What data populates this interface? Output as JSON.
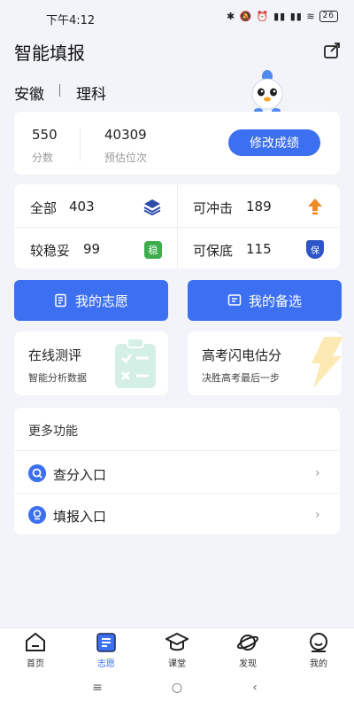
{
  "status": {
    "time": "下午4:12",
    "icons": "✱ 🔕 ⏰ ▮▮ ▮▮ ≋",
    "battery": "26"
  },
  "header": {
    "title": "智能填报"
  },
  "profile": {
    "province": "安徽",
    "subject": "理科"
  },
  "score": {
    "value": "550",
    "label": "分数",
    "rank": "40309",
    "rank_label": "预估位次",
    "edit_label": "修改成绩"
  },
  "stats": {
    "all": {
      "label": "全部",
      "count": "403"
    },
    "reach": {
      "label": "可冲击",
      "count": "189"
    },
    "stable": {
      "label": "较稳妥",
      "count": "99",
      "badge": "稳"
    },
    "safe": {
      "label": "可保底",
      "count": "115",
      "badge": "保"
    }
  },
  "actions": {
    "my_wishes": "我的志愿",
    "my_backups": "我的备选"
  },
  "features": {
    "test": {
      "title": "在线测评",
      "subtitle": "智能分析数据"
    },
    "flash": {
      "title": "高考闪电估分",
      "subtitle": "决胜高考最后一步"
    }
  },
  "more": {
    "title": "更多功能",
    "items": [
      {
        "label": "查分入口"
      },
      {
        "label": "填报入口"
      }
    ]
  },
  "tabs": [
    {
      "label": "首页",
      "icon": "home-icon"
    },
    {
      "label": "志愿",
      "icon": "wish-icon"
    },
    {
      "label": "课堂",
      "icon": "graduation-cap-icon"
    },
    {
      "label": "发现",
      "icon": "planet-icon"
    },
    {
      "label": "我的",
      "icon": "profile-icon"
    }
  ],
  "colors": {
    "accent": "#3D70F0",
    "orange": "#F08A24",
    "green": "#3DAE4E"
  }
}
